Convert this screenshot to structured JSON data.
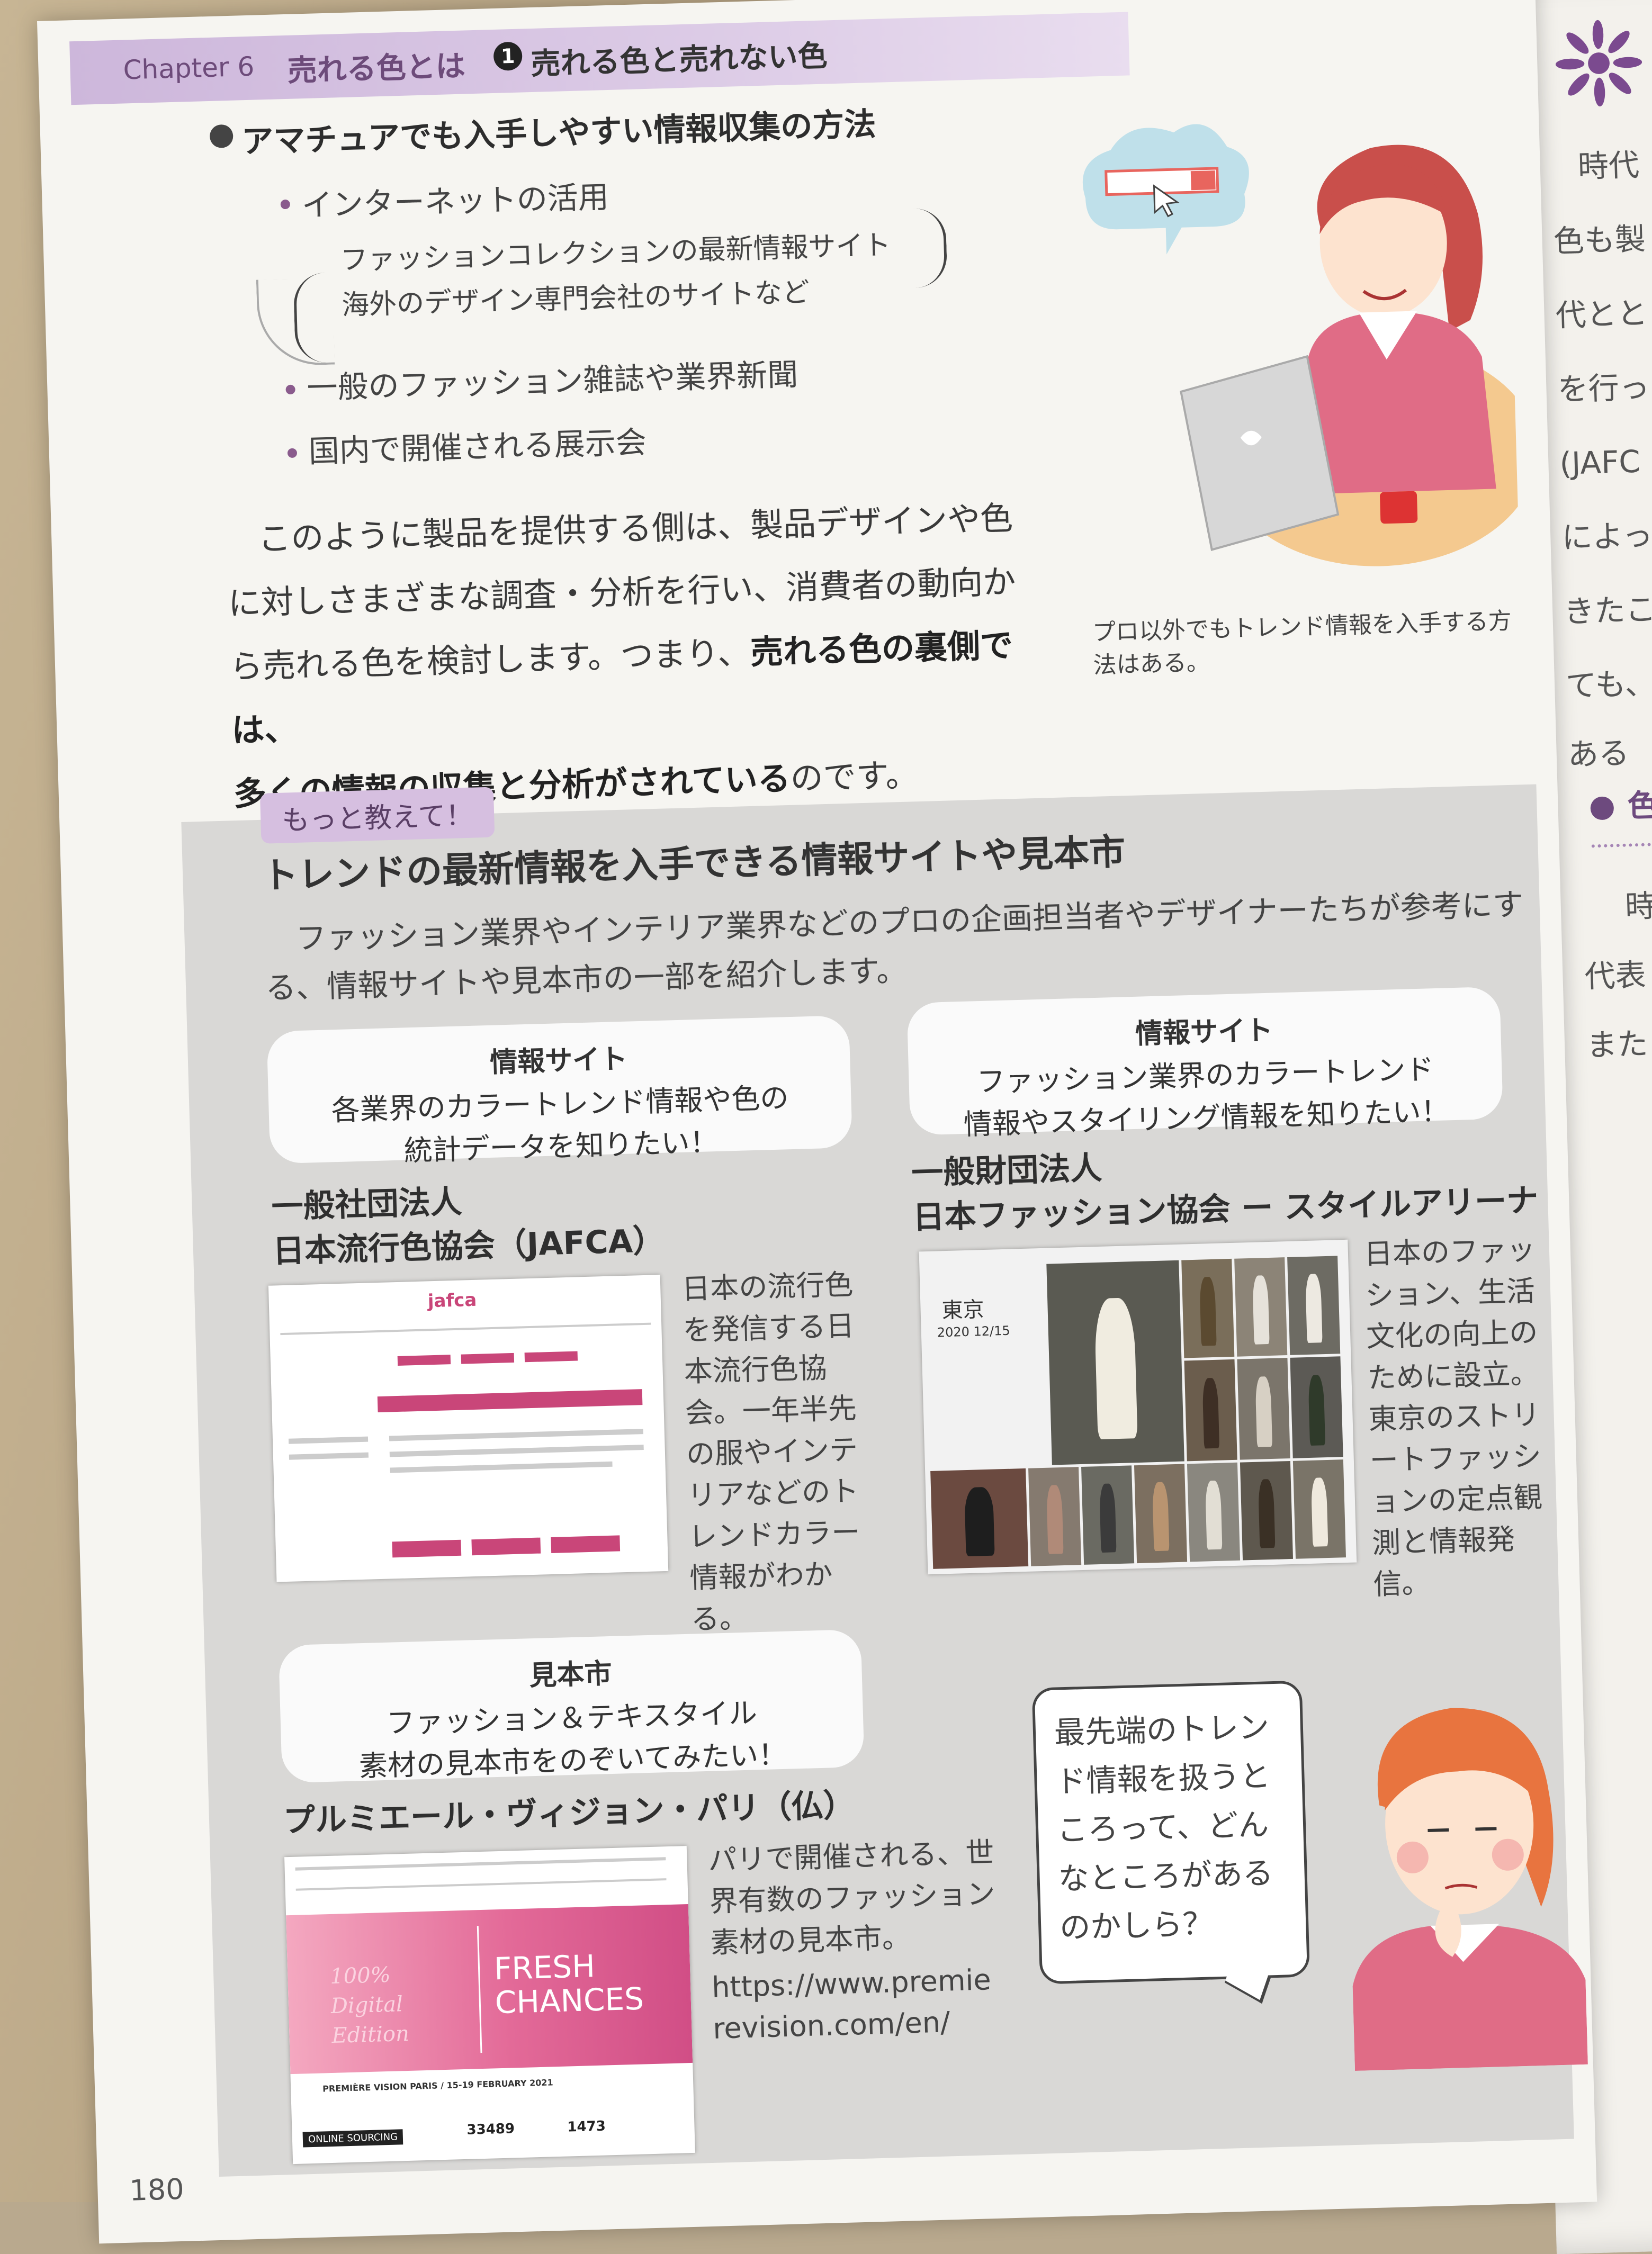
{
  "header": {
    "chapter": "Chapter 6",
    "chapter_title": "売れる色とは",
    "section_number": "1",
    "section_title": "売れる色と売れない色"
  },
  "info_methods": {
    "heading": "アマチュアでも入手しやすい情報収集の方法",
    "items": [
      "インターネットの活用",
      "一般のファッション雑誌や業界新聞",
      "国内で開催される展示会"
    ],
    "sub_items": [
      "ファッションコレクションの最新情報サイト",
      "海外のデザイン専門会社のサイトなど"
    ]
  },
  "body": {
    "line1": "このように製品を提供する側は、製品デザインや色",
    "line2": "に対しさまざまな調査・分析を行い、消費者の動向か",
    "line3_a": "ら売れる色を検討します。つまり、",
    "line3_b": "売れる色の裏側では、",
    "line4_a": "多くの情報の収集と分析がされている",
    "line4_b": "のです。"
  },
  "illustration1_caption": "プロ以外でもトレンド情報を入手する方法はある。",
  "column": {
    "tag": "もっと教えて！",
    "title": "トレンドの最新情報を入手できる情報サイトや見本市",
    "intro": "ファッション業界やインテリア業界などのプロの企画担当者やデザイナーたちが参考にする、情報サイトや見本市の一部を紹介します。",
    "cards": [
      {
        "type": "情報サイト",
        "line1": "各業界のカラートレンド情報や色の",
        "line2": "統計データを知りたい！",
        "org1": "一般社団法人",
        "org2": "日本流行色協会（JAFCA）",
        "desc": "日本の流行色を発信する日本流行色協会。一年半先の服やインテリアなどのトレンドカラー情報がわかる。",
        "screenshot_logo": "jafca"
      },
      {
        "type": "情報サイト",
        "line1": "ファッション業界のカラートレンド",
        "line2": "情報やスタイリング情報を知りたい！",
        "org1": "一般財団法人",
        "org2": "日本ファッション協会 ー スタイルアリーナ",
        "desc": "日本のファッション、生活文化の向上のために設立。東京のストリートファッションの定点観測と情報発信。",
        "screenshot_city": "東京",
        "screenshot_date": "2020 12/15"
      },
      {
        "type": "見本市",
        "line1": "ファッション＆テキスタイル",
        "line2": "素材の見本市をのぞいてみたい！",
        "org1": "プルミエール・ヴィジョン・パリ（仏）",
        "desc": "パリで開催される、世界有数のファッション素材の見本市。",
        "url1": "https://www.premie",
        "url2": "revision.com/en/",
        "screenshot_headline1": "FRESH",
        "screenshot_headline2": "CHANCES",
        "screenshot_script": "100% Digital Edition",
        "screenshot_event": "PREMIÈRE VISION PARIS / 15-19 FEBRUARY 2021",
        "screenshot_badge": "ONLINE SOURCING",
        "screenshot_stat1": "33489",
        "screenshot_stat2": "1473"
      }
    ],
    "bubble": "最先端のトレンド情報を扱うところって、どんなところがあるのかしら？"
  },
  "right_page": [
    "時代",
    "色も製",
    "代とと",
    "を行っ",
    "(JAFC",
    "によっ",
    "きたこ",
    "ても、",
    "ある",
    "色",
    "時",
    "代表",
    "また"
  ],
  "page_number": "180",
  "colors": {
    "accent_purple": "#cdb7db",
    "pink": "#d14e86",
    "grey_box": "#d9d8d6"
  }
}
